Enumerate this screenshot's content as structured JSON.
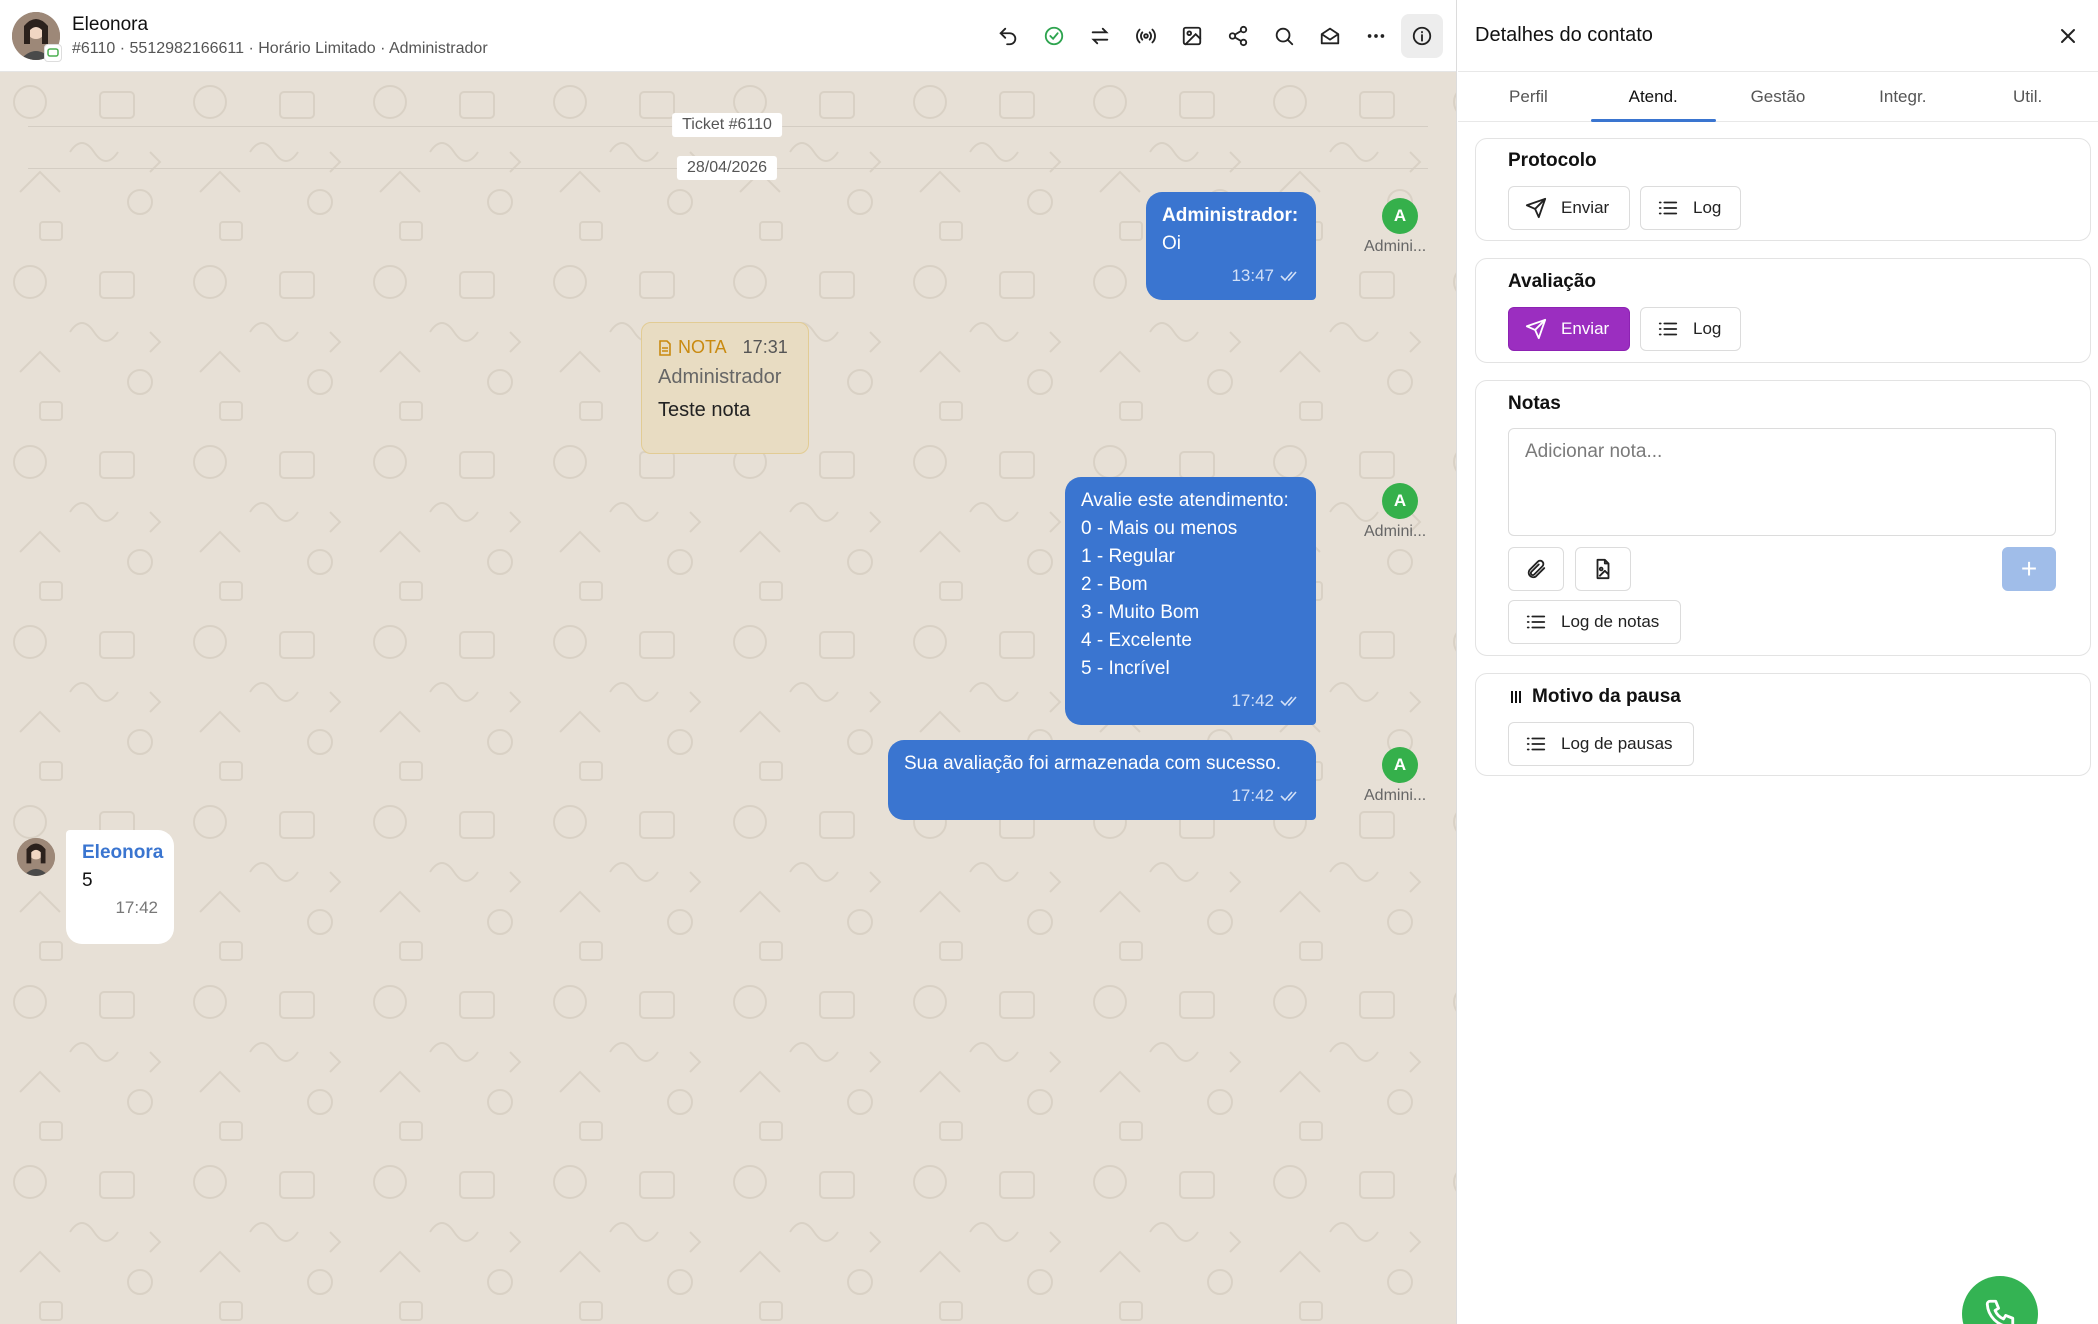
{
  "chat": {
    "contact_name": "Eleonora",
    "contact_sub": "#6110 · 5512982166611 · Horário Limitado · Administrador",
    "ticket_chip": "Ticket #6110",
    "date_chip": "28/04/2026",
    "header_icons": [
      "undo-icon",
      "check-circle-icon",
      "transfer-icon",
      "broadcast-icon",
      "image-icon",
      "share-icon",
      "search-icon",
      "mail-open-icon",
      "more-icon",
      "info-icon"
    ],
    "messages": [
      {
        "sender": "Administrador:",
        "text": "Oi",
        "time": "13:47",
        "agent_initial": "A",
        "agent_label": "Admini..."
      },
      {
        "lines": [
          "Avalie este atendimento:",
          "0 - Mais ou menos",
          "1 - Regular",
          "2 - Bom",
          "3 - Muito Bom",
          "4 - Excelente",
          "5 - Incrível"
        ],
        "time": "17:42",
        "agent_initial": "A",
        "agent_label": "Admini..."
      },
      {
        "text": "Sua avaliação foi armazenada com sucesso.",
        "time": "17:42",
        "agent_initial": "A",
        "agent_label": "Admini..."
      }
    ],
    "note": {
      "tag": "NOTA",
      "time": "17:31",
      "author": "Administrador",
      "text": "Teste nota"
    },
    "incoming": {
      "sender": "Eleonora",
      "text": "5",
      "time": "17:42"
    },
    "accent_color": "#3a75d0"
  },
  "panel": {
    "title": "Detalhes do contato",
    "tabs": [
      "Perfil",
      "Atend.",
      "Gestão",
      "Integr.",
      "Util."
    ],
    "active_tab": "Atend.",
    "protocolo": {
      "title": "Protocolo",
      "send_label": "Enviar",
      "log_label": "Log"
    },
    "avaliacao": {
      "title": "Avaliação",
      "send_label": "Enviar",
      "log_label": "Log"
    },
    "notas": {
      "title": "Notas",
      "placeholder": "Adicionar nota...",
      "log_label": "Log de notas",
      "add_label": "+"
    },
    "pausa": {
      "title": "Motivo da pausa",
      "log_label": "Log de pausas"
    },
    "primary_color": "#9b2ec0",
    "fab_color": "#34b353"
  }
}
